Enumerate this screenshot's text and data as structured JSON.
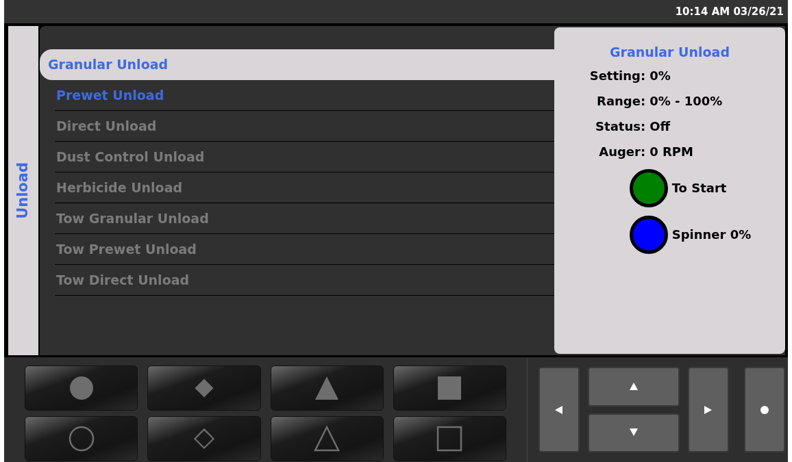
{
  "status_bar": {
    "clock": "10:14 AM 03/26/21"
  },
  "side_tab": {
    "label": "Unload"
  },
  "menu": [
    {
      "label": "Granular Unload",
      "selected": true,
      "disabled": false
    },
    {
      "label": "Prewet Unload",
      "selected": false,
      "disabled": false
    },
    {
      "label": "Direct Unload",
      "selected": false,
      "disabled": true
    },
    {
      "label": "Dust Control Unload",
      "selected": false,
      "disabled": true
    },
    {
      "label": "Herbicide Unload",
      "selected": false,
      "disabled": true
    },
    {
      "label": "Tow Granular Unload",
      "selected": false,
      "disabled": true
    },
    {
      "label": "Tow Prewet Unload",
      "selected": false,
      "disabled": true
    },
    {
      "label": "Tow Direct Unload",
      "selected": false,
      "disabled": true
    }
  ],
  "details": {
    "title": "Granular Unload",
    "fields": [
      {
        "label": "Setting:",
        "value": "0%"
      },
      {
        "label": "Range:",
        "value": "0% - 100%"
      },
      {
        "label": "Status:",
        "value": "Off"
      },
      {
        "label": "Auger:",
        "value": "0 RPM"
      }
    ],
    "indicators": [
      {
        "label": "To Start",
        "color": "#008000"
      },
      {
        "label": "Spinner 0%",
        "color": "#0000ff"
      }
    ]
  },
  "softkeys": [
    {
      "kind": "circle",
      "filled": true
    },
    {
      "kind": "diamond",
      "filled": true
    },
    {
      "kind": "triangle",
      "filled": true
    },
    {
      "kind": "square",
      "filled": true
    },
    {
      "kind": "circle",
      "filled": false
    },
    {
      "kind": "diamond",
      "filled": false
    },
    {
      "kind": "triangle",
      "filled": false
    },
    {
      "kind": "square",
      "filled": false
    }
  ]
}
